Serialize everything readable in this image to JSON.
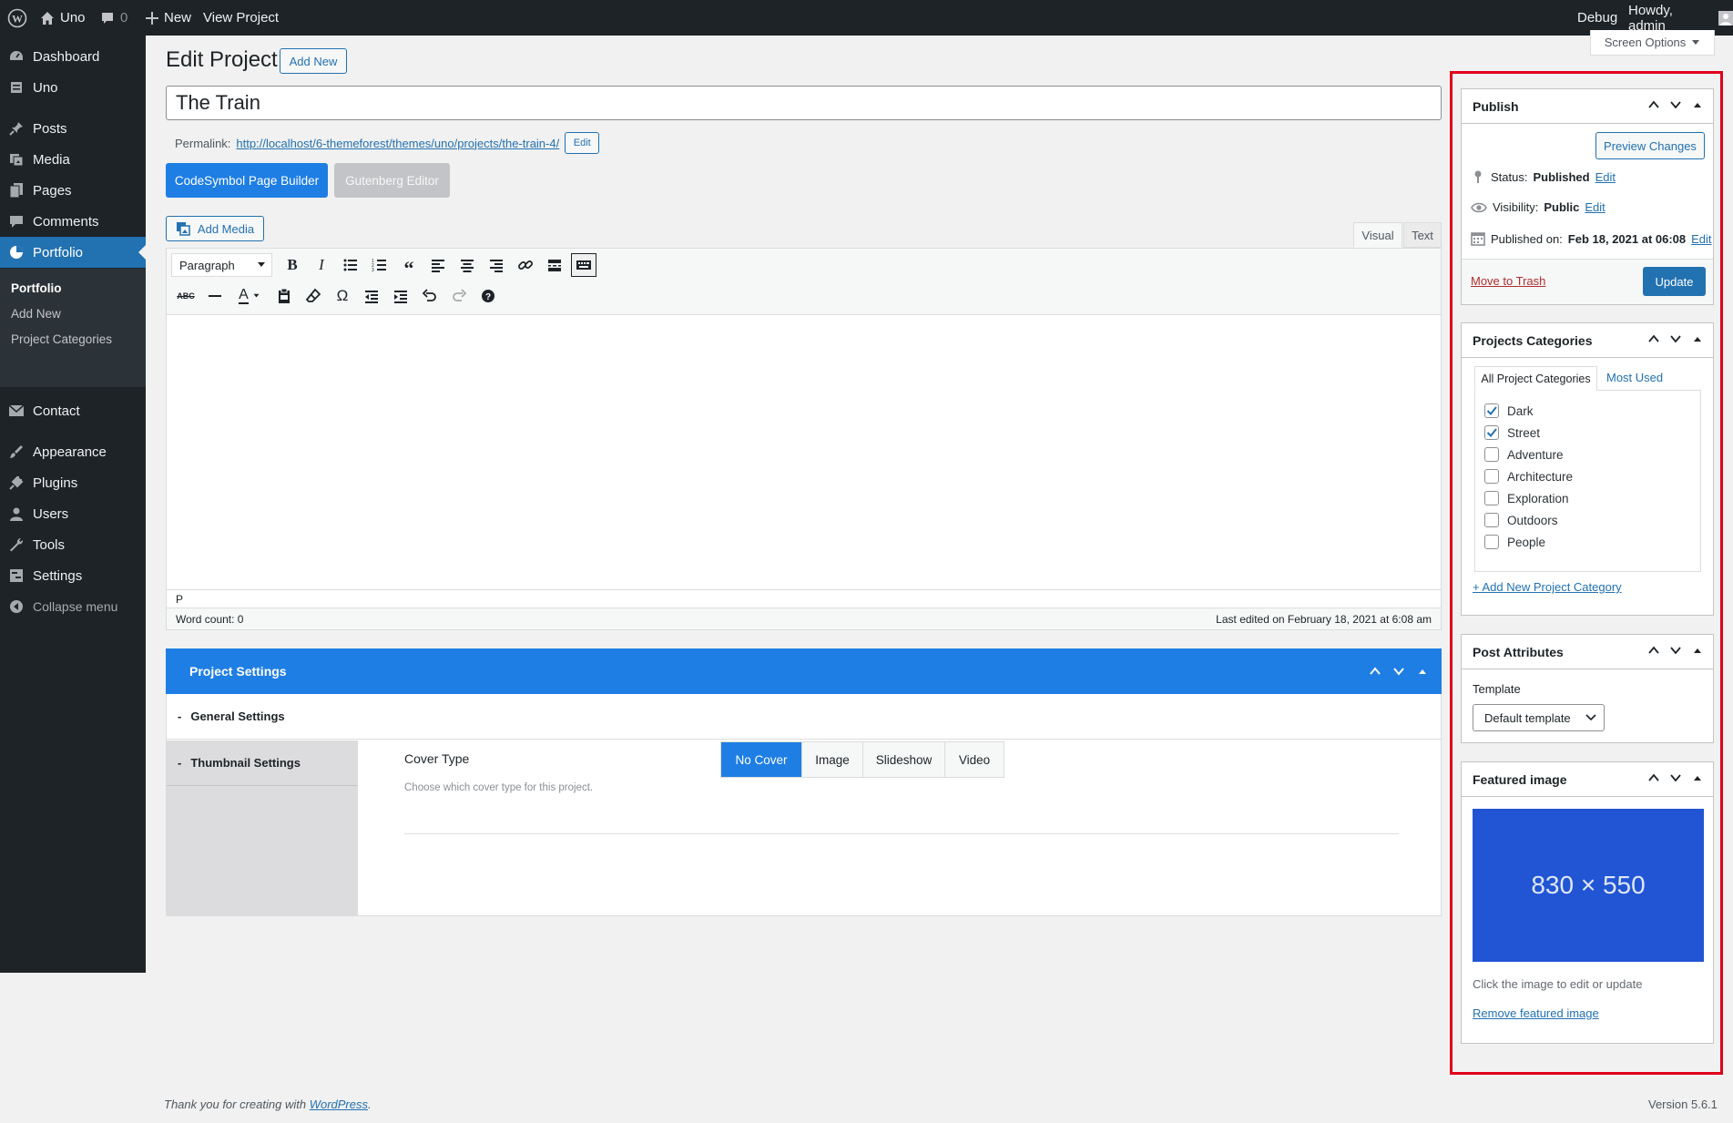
{
  "adminbar": {
    "site_name": "Uno",
    "comments_count": "0",
    "new_label": "New",
    "view_project_label": "View Project",
    "debug_label": "Debug",
    "howdy_label": "Howdy, admin"
  },
  "sidebar": {
    "items": {
      "dashboard": "Dashboard",
      "uno": "Uno",
      "posts": "Posts",
      "media": "Media",
      "pages": "Pages",
      "comments": "Comments",
      "portfolio": "Portfolio",
      "contact": "Contact",
      "appearance": "Appearance",
      "plugins": "Plugins",
      "users": "Users",
      "tools": "Tools",
      "settings": "Settings",
      "collapse": "Collapse menu"
    },
    "submenu": {
      "portfolio": "Portfolio",
      "add_new": "Add New",
      "project_categories": "Project Categories"
    }
  },
  "header": {
    "title": "Edit Project",
    "add_new": "Add New",
    "screen_options": "Screen Options"
  },
  "post": {
    "title": "The Train",
    "permalink_label": "Permalink:",
    "permalink_url": "http://localhost/6-themeforest/themes/uno/projects/the-train-4/",
    "permalink_edit": "Edit"
  },
  "builders": {
    "codesymbol": "CodeSymbol Page Builder",
    "gutenberg": "Gutenberg Editor"
  },
  "editor": {
    "add_media": "Add Media",
    "tab_visual": "Visual",
    "tab_text": "Text",
    "format_select": "Paragraph",
    "path": "P",
    "word_count": "Word count: 0",
    "last_edited": "Last edited on February 18, 2021 at 6:08 am"
  },
  "project_settings": {
    "title": "Project Settings",
    "general_settings": "General Settings",
    "thumbnail_settings": "Thumbnail Settings",
    "cover_type_label": "Cover Type",
    "cover_type_desc": "Choose which cover type for this project.",
    "cover_options": [
      "No Cover",
      "Image",
      "Slideshow",
      "Video"
    ],
    "cover_selected": "No Cover"
  },
  "publish": {
    "title": "Publish",
    "preview_changes": "Preview Changes",
    "status_label": "Status:",
    "status_value": "Published",
    "visibility_label": "Visibility:",
    "visibility_value": "Public",
    "published_on_label": "Published on:",
    "published_on_value": "Feb 18, 2021 at 06:08",
    "edit_link": "Edit",
    "move_to_trash": "Move to Trash",
    "update": "Update"
  },
  "categories": {
    "title": "Projects Categories",
    "tab_all": "All Project Categories",
    "tab_most_used": "Most Used",
    "items": [
      {
        "label": "Dark",
        "checked": true
      },
      {
        "label": "Street",
        "checked": true
      },
      {
        "label": "Adventure",
        "checked": false
      },
      {
        "label": "Architecture",
        "checked": false
      },
      {
        "label": "Exploration",
        "checked": false
      },
      {
        "label": "Outdoors",
        "checked": false
      },
      {
        "label": "People",
        "checked": false
      }
    ],
    "add_new": "+ Add New Project Category"
  },
  "attributes": {
    "title": "Post Attributes",
    "template_label": "Template",
    "template_value": "Default template"
  },
  "featured": {
    "title": "Featured image",
    "placeholder_text": "830 × 550",
    "hint": "Click the image to edit or update",
    "remove": "Remove featured image"
  },
  "footer": {
    "thanks": "Thank you for creating with ",
    "wordpress": "WordPress",
    "period": ".",
    "version": "Version 5.6.1"
  },
  "colors": {
    "accent": "#2271b1",
    "builder_blue": "#1e7ee4",
    "sidebar_bg": "#1d2327",
    "highlight_red": "#e0001b",
    "featured_bg": "#2155d4"
  }
}
